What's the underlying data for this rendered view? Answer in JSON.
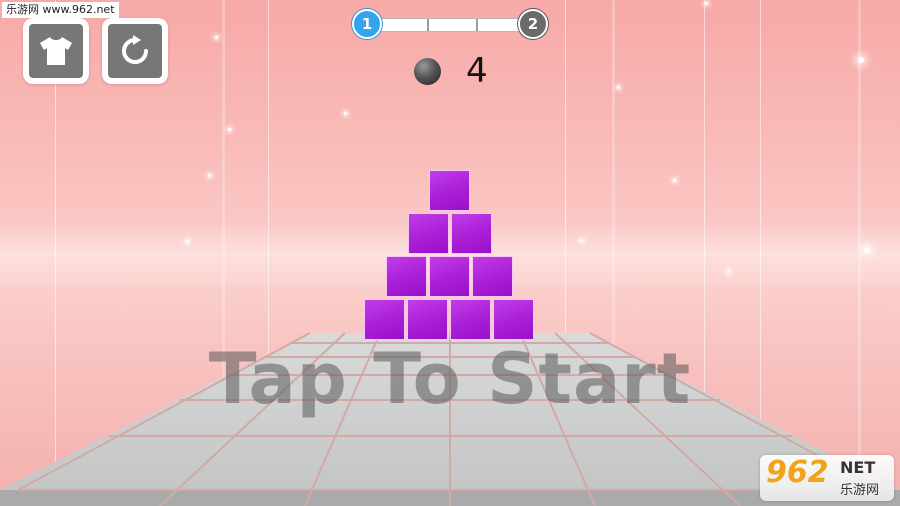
{
  "watermark": {
    "site_text": "乐游网 www.962.net"
  },
  "buttons": {
    "skin": "shirt-icon",
    "restart": "restart-icon"
  },
  "level_progress": {
    "current_level": "1",
    "next_level": "2",
    "segments": 3,
    "filled_segments": 0
  },
  "balls": {
    "count": "4",
    "icon": "ball-icon"
  },
  "pyramid": {
    "rows": [
      1,
      2,
      3,
      4
    ],
    "block_color": "#a91ed6"
  },
  "prompt": {
    "text": "Tap To Start"
  },
  "logo": {
    "digits": "962",
    "net": "NET",
    "cn": "乐游网"
  },
  "colors": {
    "accent_current": "#36a3ee",
    "accent_next": "#6a6a6a",
    "sky": "#f9bcb9"
  }
}
